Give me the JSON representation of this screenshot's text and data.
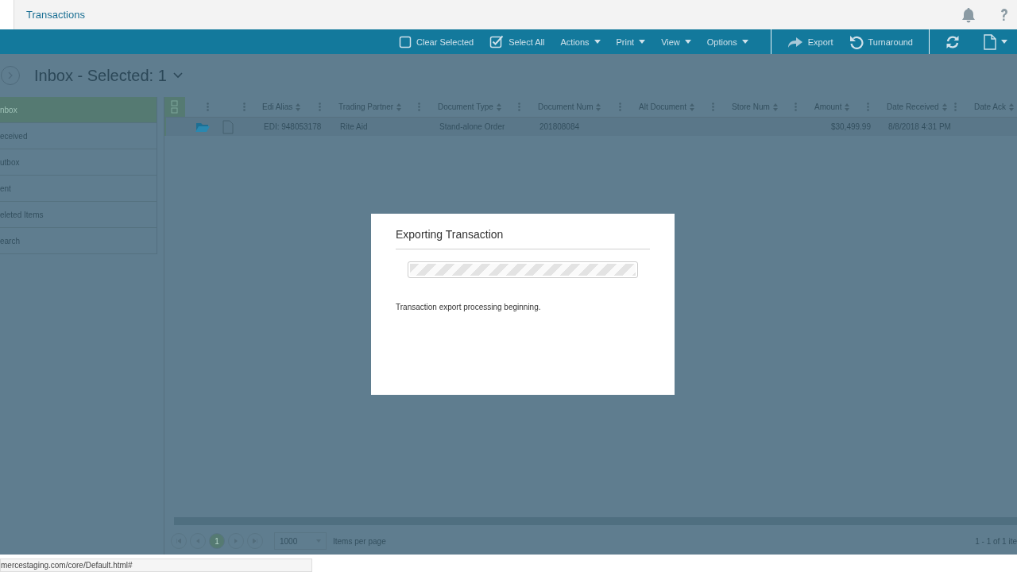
{
  "header": {
    "title": "Transactions"
  },
  "toolbar": {
    "groups": [
      [
        {
          "label": "Clear Selected",
          "kind": "button"
        },
        {
          "label": "Select All",
          "kind": "button"
        },
        {
          "label": "Actions",
          "kind": "menu"
        },
        {
          "label": "Print",
          "kind": "menu"
        },
        {
          "label": "View",
          "kind": "menu"
        },
        {
          "label": "Options",
          "kind": "menu"
        }
      ],
      [
        {
          "label": "Export",
          "kind": "button"
        },
        {
          "label": "Turnaround",
          "kind": "button"
        }
      ],
      [
        {
          "kind": "icon"
        },
        {
          "kind": "icon-menu"
        }
      ]
    ]
  },
  "page": {
    "title": "Inbox - Selected: 1"
  },
  "sidebar": {
    "items": [
      {
        "label": "nbox",
        "selected": true
      },
      {
        "label": "eceived",
        "selected": false
      },
      {
        "label": "utbox",
        "selected": false
      },
      {
        "label": "ent",
        "selected": false
      },
      {
        "label": "eleted Items",
        "selected": false
      },
      {
        "label": "earch",
        "selected": false
      }
    ]
  },
  "table": {
    "columns": [
      {
        "label": "Edi Alias"
      },
      {
        "label": "Trading Partner"
      },
      {
        "label": "Document Type"
      },
      {
        "label": "Document Num"
      },
      {
        "label": "Alt Document"
      },
      {
        "label": "Store Num"
      },
      {
        "label": "Amount"
      },
      {
        "label": "Date Received"
      },
      {
        "label": "Date Ack"
      }
    ],
    "rows": [
      {
        "selected": true,
        "cells": [
          "EDI: 948053178",
          "Rite Aid",
          "Stand-alone Order",
          "201808084",
          null,
          null,
          "$30,499.99",
          "8/8/2018 4:31 PM",
          null
        ]
      }
    ]
  },
  "pager": {
    "page": "1",
    "page_size": "1000",
    "page_size_label": "Items per page",
    "summary": "1 - 1 of 1 ite"
  },
  "dialog": {
    "title": "Exporting Transaction",
    "progress": {
      "level": 1
    },
    "message": "Transaction export processing beginning."
  },
  "status_bar": {
    "url": "mercestaging.com/core/Default.html#"
  }
}
